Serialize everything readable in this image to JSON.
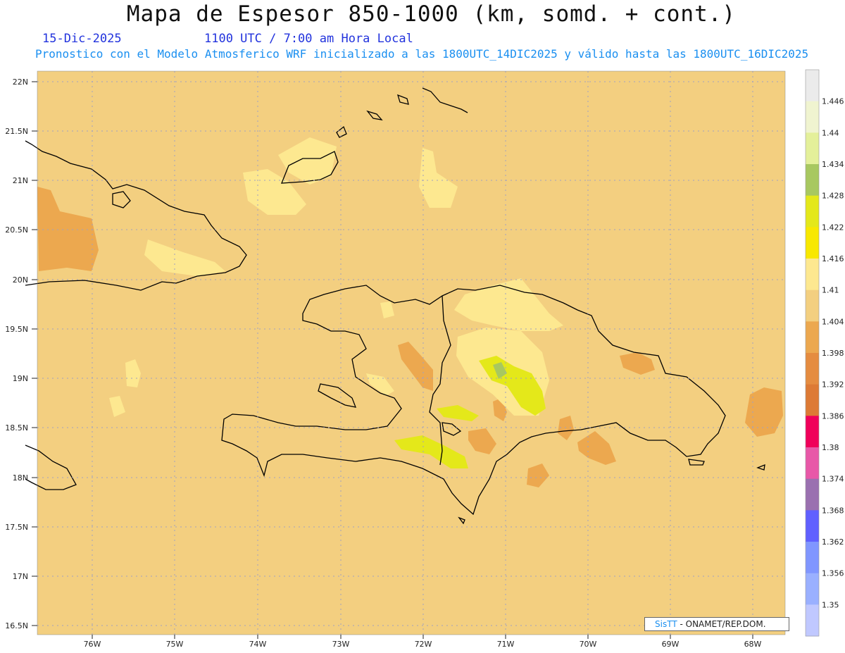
{
  "header": {
    "title": "Mapa de Espesor 850-1000 (km, somd. + cont.)",
    "date": "15-Dic-2025",
    "time": "1100 UTC / 7:00 am Hora Local",
    "subtitle": "Pronostico con el Modelo Atmosferico WRF inicializado a las 1800UTC_14DIC2025 y válido hasta las  1800UTC_16DIC2025"
  },
  "map": {
    "lat_labels": [
      "22N",
      "21.5N",
      "21N",
      "20.5N",
      "20N",
      "19.5N",
      "19N",
      "18.5N",
      "18N",
      "17.5N",
      "17N",
      "16.5N"
    ],
    "lon_labels": [
      "76W",
      "75W",
      "74W",
      "73W",
      "72W",
      "71W",
      "70W",
      "69W",
      "68W"
    ],
    "background_color": "#f3cf80",
    "coastline_color": "#000000",
    "grid_style": "dotted"
  },
  "colorbar": {
    "colors": [
      "#c0c8ff",
      "#9ab0ff",
      "#8096ff",
      "#6060ff",
      "#9a70b0",
      "#e858a8",
      "#f0005a",
      "#dd7a35",
      "#e58c40",
      "#eca84f",
      "#f3cf80",
      "#fde890",
      "#f8e800",
      "#e4e81a",
      "#a8c860",
      "#e4f09a",
      "#f0f4d0",
      "#ebebeb"
    ],
    "labels": [
      "1.35",
      "1.356",
      "1.362",
      "1.368",
      "1.374",
      "1.38",
      "1.386",
      "1.392",
      "1.398",
      "1.404",
      "1.41",
      "1.416",
      "1.422",
      "1.428",
      "1.434",
      "1.44",
      "1.446"
    ]
  },
  "credit": {
    "brand": "SisTT",
    "text": "- ONAMET/REP.DOM."
  }
}
